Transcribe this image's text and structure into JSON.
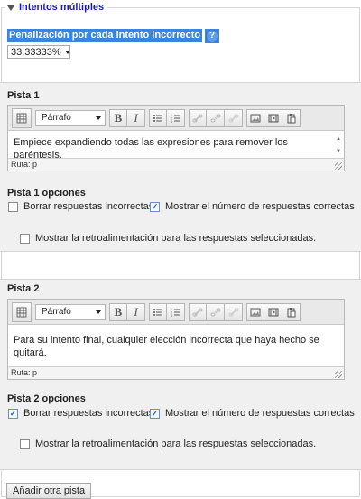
{
  "section": {
    "title": "Intentos múltiples"
  },
  "penalty": {
    "label": "Penalización por cada intento incorrecto",
    "help_icon": "?",
    "selected": "33.33333%"
  },
  "editor": {
    "format_label": "Párrafo",
    "bold": "B",
    "italic": "I",
    "status_prefix": "Ruta: p"
  },
  "hints": [
    {
      "title": "Pista 1",
      "text": "Empiece expandiendo todas las expresiones para remover los paréntesis.",
      "options_title": "Pista 1 opciones",
      "clear_wrong": {
        "label": "Borrar respuestas incorrectas",
        "checked": false
      },
      "show_num_correct": {
        "label": "Mostrar el número de respuestas correctas",
        "checked": true
      },
      "show_feedback": {
        "label": "Mostrar la retroalimentación para las respuestas seleccionadas.",
        "checked": false
      }
    },
    {
      "title": "Pista 2",
      "text": "Para su intento final, cualquier elección incorrecta que haya hecho se quitará.",
      "options_title": "Pista 2 opciones",
      "clear_wrong": {
        "label": "Borrar respuestas incorrectas",
        "checked": true
      },
      "show_num_correct": {
        "label": "Mostrar el número de respuestas correctas",
        "checked": true
      },
      "show_feedback": {
        "label": "Mostrar la retroalimentación para las respuestas seleccionadas.",
        "checked": false
      }
    }
  ],
  "add_hint_label": "Añadir otra pista"
}
